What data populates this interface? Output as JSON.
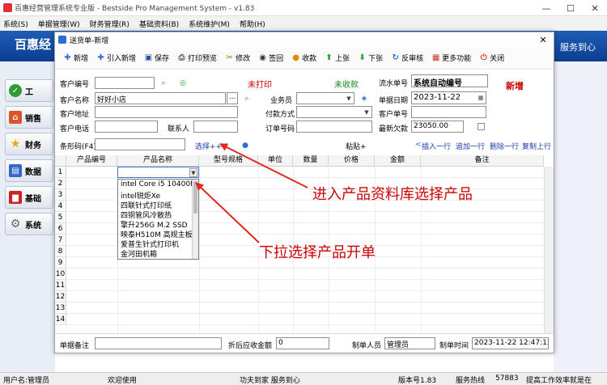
{
  "window": {
    "title": "百惠经营管理系统专业版 - Bestside Pro Management System  - v1.83",
    "minimize": "—",
    "maximize": "☐",
    "close": "✕"
  },
  "menu": {
    "items": [
      "系统(S)",
      "单据管理(W)",
      "财务管理(R)",
      "基础资料(B)",
      "系统维护(M)",
      "帮助(H)"
    ]
  },
  "banner": {
    "brand": "百惠经",
    "slogan": "服务到心"
  },
  "leftnav": {
    "items": [
      "工",
      "销售",
      "财务",
      "数据",
      "基础",
      "系统"
    ]
  },
  "statusbar": {
    "user": "用户名:管理员",
    "welcome": "欢迎使用",
    "motto": "功夫到家 服务到心",
    "version": "版本号1.83",
    "service_label": "服务热线",
    "service_number": "57883",
    "tagline": "提高工作效率就是在"
  },
  "dialog": {
    "title": "送货单-新增",
    "close": "✕",
    "toolbar": [
      "新增",
      "引入新增",
      "保存",
      "打印预览",
      "修改",
      "签回",
      "收款",
      "上张",
      "下张",
      "反审核",
      "更多功能",
      "关闭"
    ],
    "status_print": "未打印",
    "status_pay": "未收款",
    "status_new": "新增",
    "form": {
      "customer_code_label": "客户编号",
      "customer_code": "",
      "customer_name_label": "客户名称",
      "customer_name": "好好小店",
      "customer_name_btn": "...",
      "customer_addr_label": "客户地址",
      "customer_addr": "",
      "customer_phone_label": "客户电话",
      "customer_phone": "",
      "contact_label": "联系人",
      "contact": "",
      "salesman_label": "业务员",
      "salesman": "",
      "pay_method_label": "付款方式",
      "pay_method": "",
      "order_no_label": "订单号码",
      "order_no": "",
      "serial_label": "流水单号",
      "serial": "系统自动编号",
      "date_label": "单据日期",
      "date": "2023-11-22",
      "cust_bill_label": "客户单号",
      "cust_bill": "",
      "arrears_label": "最新欠款",
      "arrears": "23050.00",
      "barcode_label": "条形码(F4)",
      "barcode": "",
      "select_link": "选择++",
      "paste_link": "粘贴+",
      "insert_row": "插入一行",
      "append_row": "追加一行",
      "delete_row": "删除一行",
      "copy_row": "复制上行"
    },
    "grid": {
      "headers": [
        "产品编号",
        "产品名称",
        "型号规格",
        "单位",
        "数量",
        "价格",
        "金额",
        "备注"
      ],
      "row_numbers": [
        "1",
        "2",
        "3",
        "4",
        "5",
        "6",
        "7",
        "8",
        "9",
        "10",
        "11",
        "12",
        "13",
        "14"
      ],
      "combo_value": "",
      "dropdown_options": [
        "intel Core i5 10400F",
        "intel锐炬Xe",
        "四联针式打印纸",
        "四铜管风冷散热",
        "擎升256G M.2 SSD",
        "映泰H510M 高规主板",
        "爱普生针式打印机",
        "金河田机箱"
      ]
    },
    "footer": {
      "remark_label": "单据备注",
      "remark": "",
      "discount_label": "折后应收金额",
      "discount": "0",
      "maker_label": "制单人员",
      "maker": "管理员",
      "time_label": "制单时间",
      "time": "2023-11-22 12:47:12"
    }
  },
  "annotations": {
    "enter_library": "进入产品资料库选择产品",
    "dropdown_select": "下拉选择产品开单"
  }
}
